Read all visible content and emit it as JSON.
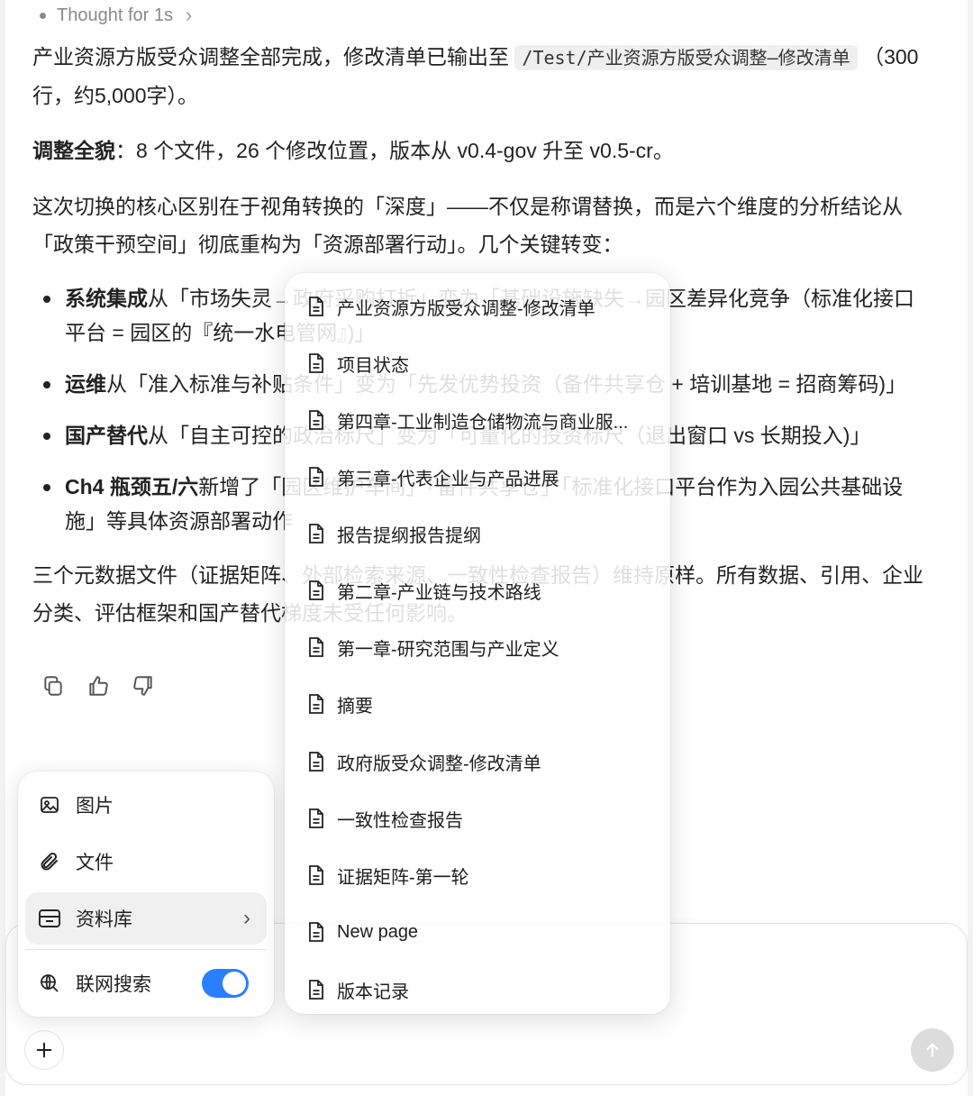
{
  "thought": {
    "label": "Thought for 1s"
  },
  "message": {
    "p1_before": "产业资源方版受众调整全部完成，修改清单已输出至",
    "p1_code": "/Test/产业资源方版受众调整–修改清单",
    "p1_after_line1": "（300",
    "p1_line2": "行，约5,000字）。",
    "p2_bold": "调整全貌",
    "p2_rest": "：8 个文件，26 个修改位置，版本从 v0.4-gov 升至 v0.5-cr。",
    "p3_line1": "这次切换的核心区别在于视角转换的「深度」——不仅是称谓替换，而是六个维度的分析结论从",
    "p3_line2": "「政策干预空间」彻底重构为「资源部署行动」。几个关键转变：",
    "bullets": [
      {
        "bold": "系统集成",
        "line1": "从「市场失灵→政府采购打折」变为「基础设施缺失→园区差异化竞争（标准化接口",
        "line2": "平台 = 园区的『统一水电管网』)」"
      },
      {
        "bold": "运维",
        "line1": "从「准入标准与补贴条件」变为「先发优势投资（备件共享仓 + 培训基地 = 招商筹码)」",
        "line2": ""
      },
      {
        "bold": "国产替代",
        "line1": "从「自主可控的政治标尺」变为「可量化的投资标尺（退出窗口 vs 长期投入)」",
        "line2": ""
      },
      {
        "bold": "Ch4 瓶颈五/六",
        "line1": "新增了「园区维护车间」「备件共享仓」「标准化接口平台作为入园公共基础设",
        "line2": "施」等具体资源部署动作"
      }
    ],
    "p4_line1": "三个元数据文件（证据矩阵、外部检索来源、一致性检查报告）维持原样。所有数据、引用、企业",
    "p4_line2": "分类、评估框架和国产替代梯度未受任何影响。"
  },
  "actions": {
    "copy": "copy-icon",
    "like": "thumbs-up-icon",
    "dislike": "thumbs-down-icon"
  },
  "attach_menu": {
    "items": [
      {
        "label": "图片",
        "icon": "image-icon"
      },
      {
        "label": "文件",
        "icon": "paperclip-icon"
      },
      {
        "label": "资料库",
        "icon": "archive-icon"
      },
      {
        "label": "联网搜索",
        "icon": "web-search-icon"
      }
    ],
    "web_search_enabled": true
  },
  "library": {
    "items": [
      "产业资源方版受众调整-修改清单",
      "项目状态",
      "第四章-工业制造仓储物流与商业服...",
      "第三章-代表企业与产品进展",
      "报告提纲报告提纲",
      "第二章-产业链与技术路线",
      "第一章-研究范围与产业定义",
      "摘要",
      "政府版受众调整-修改清单",
      "一致性检查报告",
      "证据矩阵-第一轮",
      "New page",
      "版本记录"
    ]
  },
  "colors": {
    "accent": "#2a7fff",
    "send_disabled": "#dcdcdc"
  }
}
